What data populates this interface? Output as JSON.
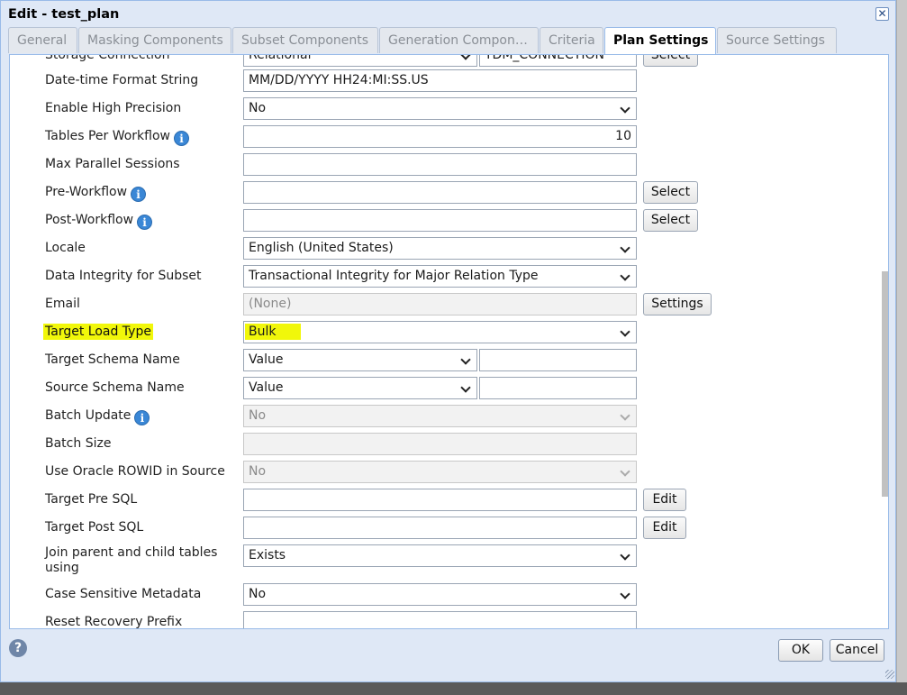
{
  "window": {
    "title": "Edit - test_plan",
    "close_symbol": "✕"
  },
  "tabs": [
    {
      "label": "General",
      "active": false
    },
    {
      "label": "Masking Components",
      "active": false
    },
    {
      "label": "Subset Components",
      "active": false
    },
    {
      "label": "Generation Compon…",
      "active": false
    },
    {
      "label": "Criteria",
      "active": false
    },
    {
      "label": "Plan Settings",
      "active": true
    },
    {
      "label": "Source Settings",
      "active": false
    }
  ],
  "partial_row": {
    "label": "Storage Connection",
    "select_value": "Relational",
    "text_value": "TDM_CONNECTION",
    "button": "Select"
  },
  "fields": {
    "datetime_format": {
      "label": "Date-time Format String",
      "value": "MM/DD/YYYY HH24:MI:SS.US"
    },
    "high_precision": {
      "label": "Enable High Precision",
      "value": "No"
    },
    "tables_per_workflow": {
      "label": "Tables Per Workflow",
      "value": "10"
    },
    "max_parallel": {
      "label": "Max Parallel Sessions",
      "value": ""
    },
    "pre_workflow": {
      "label": "Pre-Workflow",
      "value": "",
      "button": "Select"
    },
    "post_workflow": {
      "label": "Post-Workflow",
      "value": "",
      "button": "Select"
    },
    "locale": {
      "label": "Locale",
      "value": "English (United States)"
    },
    "data_integrity": {
      "label": "Data Integrity for Subset",
      "value": "Transactional Integrity for Major Relation Type"
    },
    "email": {
      "label": "Email",
      "value": "(None)",
      "button": "Settings"
    },
    "target_load_type": {
      "label": "Target Load Type",
      "value": "Bulk"
    },
    "target_schema": {
      "label": "Target Schema Name",
      "mode": "Value",
      "value": ""
    },
    "source_schema": {
      "label": "Source Schema Name",
      "mode": "Value",
      "value": ""
    },
    "batch_update": {
      "label": "Batch Update",
      "value": "No"
    },
    "batch_size": {
      "label": "Batch Size",
      "value": ""
    },
    "oracle_rowid": {
      "label": "Use Oracle ROWID in Source",
      "value": "No"
    },
    "target_pre_sql": {
      "label": "Target Pre SQL",
      "value": "",
      "button": "Edit"
    },
    "target_post_sql": {
      "label": "Target Post SQL",
      "value": "",
      "button": "Edit"
    },
    "join_parent_child": {
      "label": "Join parent and child tables using",
      "value": "Exists"
    },
    "case_sensitive": {
      "label": "Case Sensitive Metadata",
      "value": "No"
    },
    "reset_recovery": {
      "label": "Reset Recovery Prefix",
      "value": ""
    }
  },
  "info_icon_glyph": "i",
  "footer": {
    "help_symbol": "?",
    "ok": "OK",
    "cancel": "Cancel"
  },
  "colors": {
    "highlight": "#f1f70a",
    "dialog_bg": "#dfe8f6",
    "border": "#99bbe8"
  }
}
